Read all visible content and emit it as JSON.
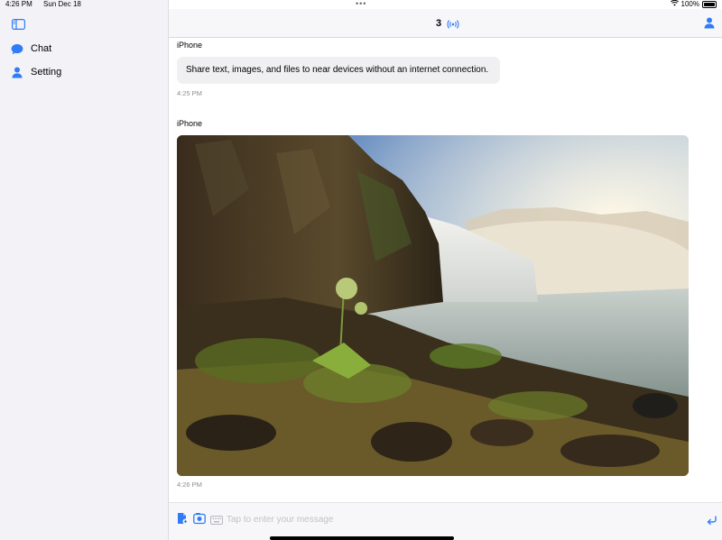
{
  "status_bar": {
    "time": "4:26 PM",
    "date": "Sun Dec 18",
    "battery": "100%"
  },
  "sidebar": {
    "items": [
      {
        "label": "Chat",
        "icon": "chat-bubble-icon"
      },
      {
        "label": "Setting",
        "icon": "person-icon"
      }
    ]
  },
  "header": {
    "peer_count": "3"
  },
  "messages": [
    {
      "sender": "iPhone",
      "text": "Share text, images, and files to near devices without an internet connection.",
      "time": "4:25 PM"
    },
    {
      "sender": "iPhone",
      "image": "waterfall-landscape-photo",
      "time": "4:26 PM"
    }
  ],
  "input": {
    "placeholder": "Tap to enter your message"
  },
  "colors": {
    "accent": "#2f7cf6",
    "sidebar_bg": "#f2f2f7",
    "bubble_bg": "#f0f0f2"
  }
}
